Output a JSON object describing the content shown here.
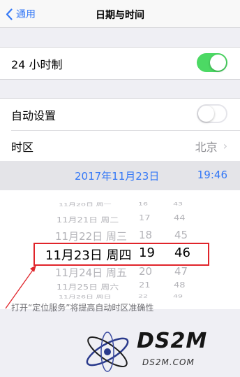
{
  "nav": {
    "back_label": "通用",
    "title": "日期与时间"
  },
  "settings": {
    "hour24": {
      "label": "24 小时制",
      "enabled": true
    },
    "auto_set": {
      "label": "自动设置",
      "enabled": false
    },
    "timezone": {
      "label": "时区",
      "value": "北京"
    }
  },
  "datebar": {
    "date": "2017年11月23日",
    "time": "19:46"
  },
  "picker": {
    "rows": [
      {
        "date": "11月20日 周一",
        "hour": "16",
        "minute": "43"
      },
      {
        "date": "11月21日 周二",
        "hour": "17",
        "minute": "44"
      },
      {
        "date": "11月22日 周三",
        "hour": "18",
        "minute": "45"
      },
      {
        "date": "11月23日 周四",
        "hour": "19",
        "minute": "46"
      },
      {
        "date": "11月24日 周五",
        "hour": "20",
        "minute": "47"
      },
      {
        "date": "11月25日 周六",
        "hour": "21",
        "minute": "48"
      },
      {
        "date": "11月26日 周日",
        "hour": "22",
        "minute": "49"
      }
    ]
  },
  "footer": {
    "note": "打开“定位服务”将提高自动时区准确性"
  },
  "watermark": {
    "title": "DS2M",
    "subtitle": "DS2M.COM"
  },
  "colors": {
    "accent": "#3478f6",
    "switch_on": "#4cd964",
    "annotation": "#e0242a"
  }
}
